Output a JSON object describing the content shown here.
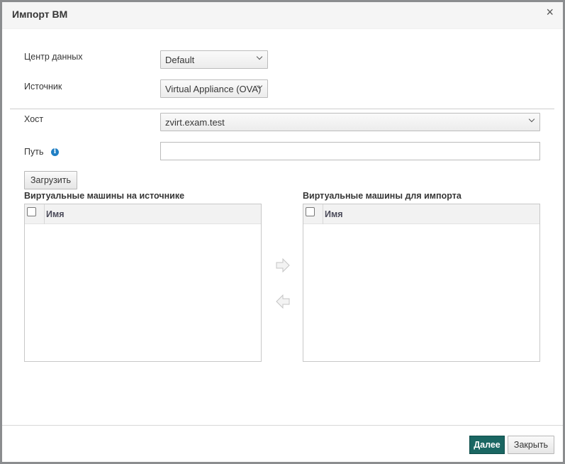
{
  "dialog": {
    "title": "Импорт ВМ",
    "close_symbol": "×"
  },
  "form": {
    "datacenter": {
      "label": "Центр данных",
      "value": "Default"
    },
    "source": {
      "label": "Источник",
      "value": "Virtual Appliance (OVA)"
    },
    "host": {
      "label": "Хост",
      "value": "zvirt.exam.test"
    },
    "path": {
      "label": "Путь",
      "value": "",
      "info_icon": "info-icon"
    },
    "load_button": "Загрузить"
  },
  "source_vms": {
    "title": "Виртуальные машины на источнике",
    "column": "Имя",
    "rows": []
  },
  "import_vms": {
    "title": "Виртуальные машины для импорта",
    "column": "Имя",
    "rows": []
  },
  "transfer": {
    "right_icon": "arrow-right-icon",
    "left_icon": "arrow-left-icon"
  },
  "footer": {
    "next_label": "Далее",
    "close_label": "Закрыть",
    "primary_color": "#1a6662"
  }
}
